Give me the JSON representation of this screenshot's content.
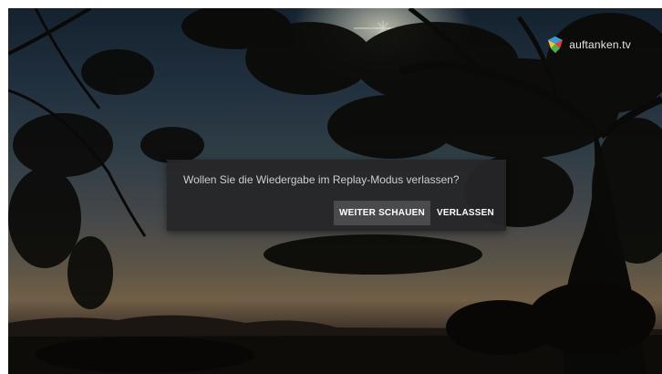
{
  "brand": {
    "logo_text": "auftanken.tv",
    "logo_icon": "auftanken-logo-icon"
  },
  "dialog": {
    "message": "Wollen Sie die Wiedergabe im Replay-Modus verlassen?",
    "continue_label": "WEITER SCHAUEN",
    "leave_label": "VERLASSEN"
  },
  "colors": {
    "dialog_bg": "#262628",
    "focused_button_bg": "#4a4a4c",
    "text": "#cfcfcf"
  }
}
